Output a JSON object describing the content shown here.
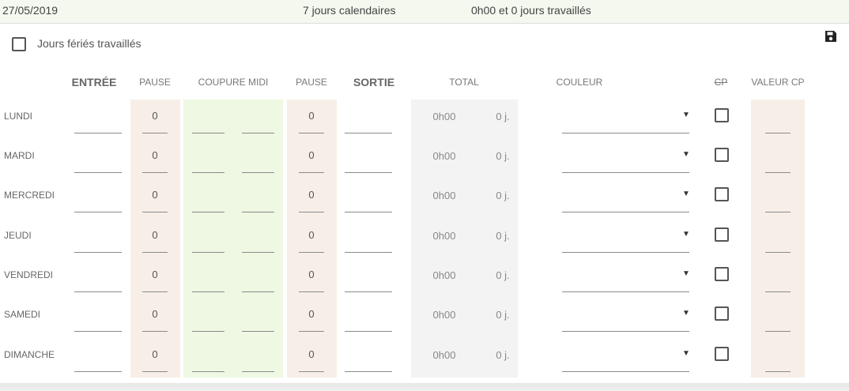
{
  "header": {
    "date": "27/05/2019",
    "calendar_days": "7 jours calendaires",
    "worked": "0h00 et 0 jours travaillés"
  },
  "ferie": {
    "label": "Jours fériés travaillés",
    "checked": false
  },
  "columns": {
    "entree": "ENTRÉE",
    "pause1": "PAUSE",
    "coupure": "COUPURE MIDI",
    "pause2": "PAUSE",
    "sortie": "SORTIE",
    "total": "TOTAL",
    "couleur": "COULEUR",
    "cp": "CP",
    "valeur_cp": "VALEUR CP"
  },
  "rows": [
    {
      "day": "LUNDI",
      "pause1": "0",
      "pause2": "0",
      "total_hours": "0h00",
      "total_days": "0 j."
    },
    {
      "day": "MARDI",
      "pause1": "0",
      "pause2": "0",
      "total_hours": "0h00",
      "total_days": "0 j."
    },
    {
      "day": "MERCREDI",
      "pause1": "0",
      "pause2": "0",
      "total_hours": "0h00",
      "total_days": "0 j."
    },
    {
      "day": "JEUDI",
      "pause1": "0",
      "pause2": "0",
      "total_hours": "0h00",
      "total_days": "0 j."
    },
    {
      "day": "VENDREDI",
      "pause1": "0",
      "pause2": "0",
      "total_hours": "0h00",
      "total_days": "0 j."
    },
    {
      "day": "SAMEDI",
      "pause1": "0",
      "pause2": "0",
      "total_hours": "0h00",
      "total_days": "0 j."
    },
    {
      "day": "DIMANCHE",
      "pause1": "0",
      "pause2": "0",
      "total_hours": "0h00",
      "total_days": "0 j."
    }
  ],
  "icons": {
    "save": "save-icon",
    "dropdown": "dropdown-arrow-icon"
  }
}
